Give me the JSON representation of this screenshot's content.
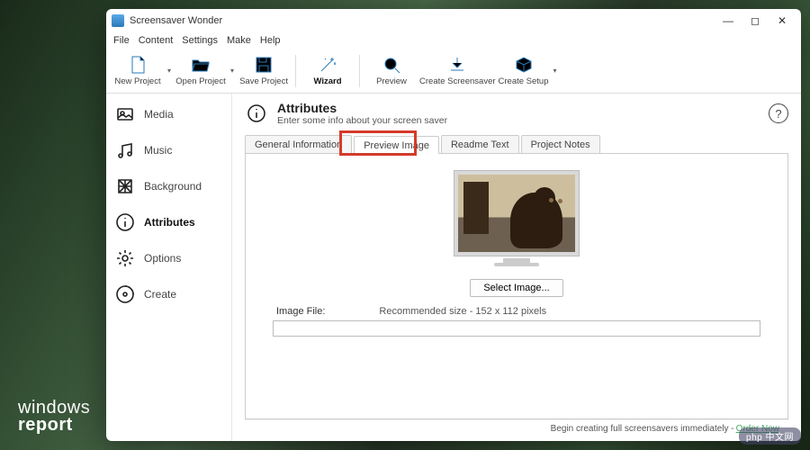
{
  "watermark": {
    "line1": "windows",
    "line2": "report"
  },
  "window": {
    "title": "Screensaver Wonder",
    "menu": [
      "File",
      "Content",
      "Settings",
      "Make",
      "Help"
    ]
  },
  "toolbar": {
    "new_project": "New Project",
    "open_project": "Open Project",
    "save_project": "Save Project",
    "wizard": "Wizard",
    "preview": "Preview",
    "create_screensaver": "Create Screensaver",
    "create_setup": "Create Setup"
  },
  "sidebar": {
    "items": [
      {
        "label": "Media"
      },
      {
        "label": "Music"
      },
      {
        "label": "Background"
      },
      {
        "label": "Attributes",
        "selected": true
      },
      {
        "label": "Options"
      },
      {
        "label": "Create"
      }
    ]
  },
  "main": {
    "title": "Attributes",
    "subtitle": "Enter some info about your screen saver",
    "tabs": [
      {
        "label": "General Information"
      },
      {
        "label": "Preview Image",
        "active": true,
        "highlighted": true
      },
      {
        "label": "Readme Text"
      },
      {
        "label": "Project Notes"
      }
    ],
    "preview": {
      "select_button": "Select Image...",
      "image_file_label": "Image File:",
      "recommended": "Recommended size - 152 x 112 pixels",
      "file_value": ""
    }
  },
  "footer": {
    "text": "Begin creating full screensavers immediately - ",
    "link": "Order Now"
  },
  "stamp": "php 中文网"
}
